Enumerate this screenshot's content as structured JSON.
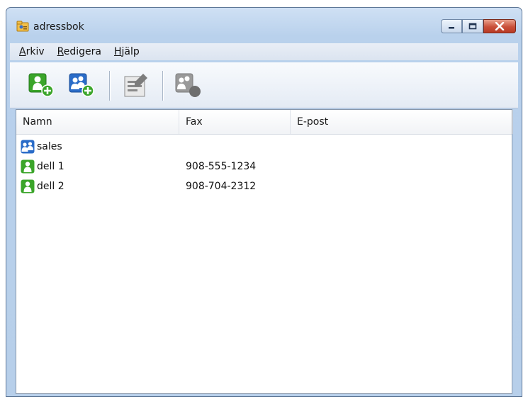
{
  "window": {
    "title": "adressbok"
  },
  "menu": [
    {
      "label": "Arkiv"
    },
    {
      "label": "Redigera"
    },
    {
      "label": "Hjälp"
    }
  ],
  "columns": [
    {
      "label": "Namn"
    },
    {
      "label": "Fax"
    },
    {
      "label": "E-post"
    }
  ],
  "rows": [
    {
      "name": "sales",
      "fax": "",
      "email": "",
      "icon": "group-icon"
    },
    {
      "name": "dell 1",
      "fax": "908-555-1234",
      "email": "",
      "icon": "contact-icon"
    },
    {
      "name": "dell 2",
      "fax": "908-704-2312",
      "email": "",
      "icon": "contact-icon"
    }
  ],
  "colors": {
    "contact_green": "#3ba52a",
    "group_blue": "#2a6cc8",
    "close_red": "#c9503a"
  }
}
